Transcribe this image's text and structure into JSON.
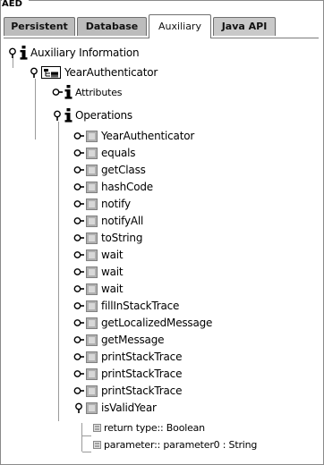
{
  "window": {
    "caption": "AED"
  },
  "tabs": [
    {
      "label": "Persistent",
      "active": false
    },
    {
      "label": "Database",
      "active": false
    },
    {
      "label": "Auxiliary",
      "active": true
    },
    {
      "label": "Java API",
      "active": false
    }
  ],
  "tree": {
    "root": "Auxiliary Information",
    "class_node": "YearAuthenticator",
    "attributes": "Attributes",
    "operations": "Operations",
    "methods": [
      "YearAuthenticator",
      "equals",
      "getClass",
      "hashCode",
      "notify",
      "notifyAll",
      "toString",
      "wait",
      "wait",
      "wait",
      "fillInStackTrace",
      "getLocalizedMessage",
      "getMessage",
      "printStackTrace",
      "printStackTrace",
      "printStackTrace",
      "isValidYear"
    ],
    "details": [
      "return type:: Boolean",
      "parameter:: parameter0 : String"
    ]
  },
  "colors": {
    "tab_bg": "#bcbcbc",
    "tab_active": "#ffffff",
    "method_icon": "#a8a8a8"
  }
}
